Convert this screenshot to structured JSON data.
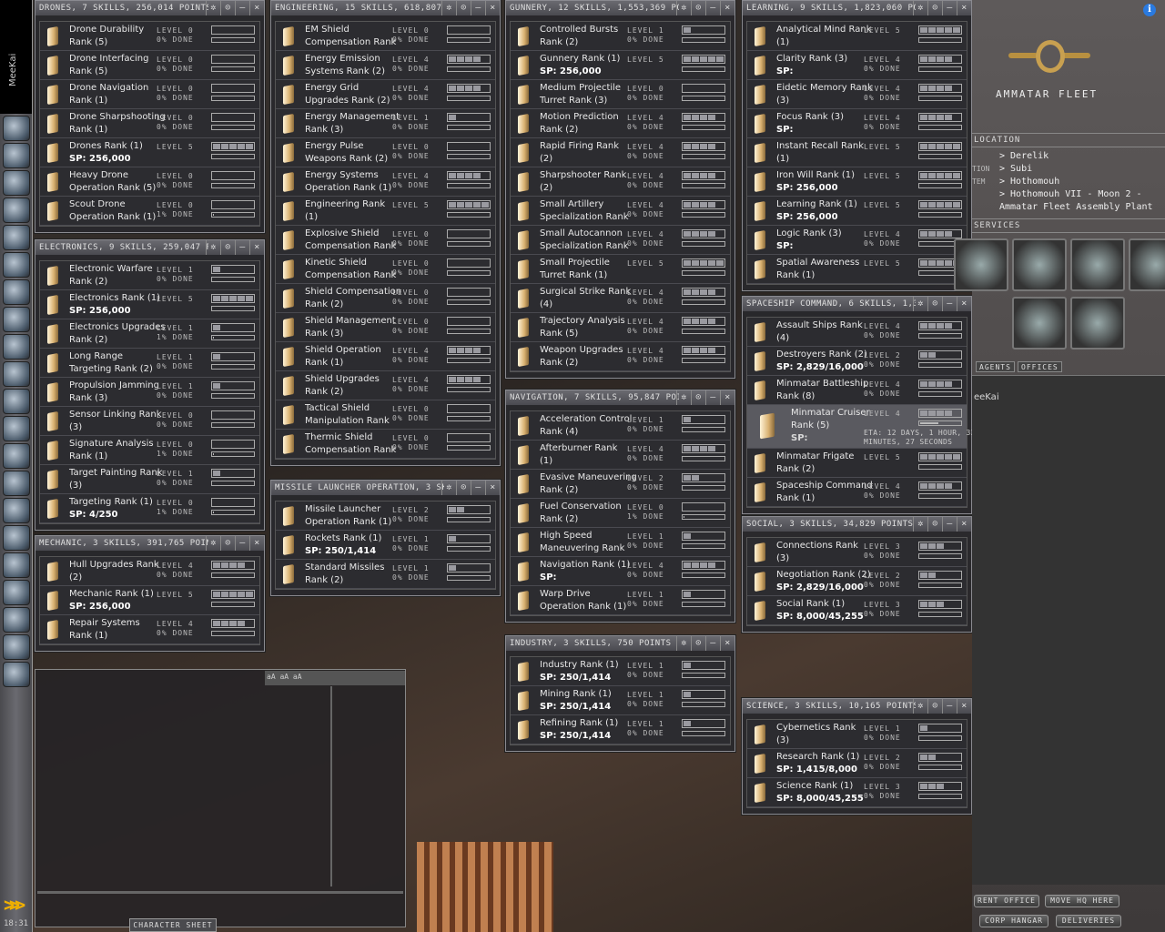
{
  "sidebar": {
    "character": "MeeKai",
    "clock": "18:31",
    "icons": [
      "character-sheet",
      "people-places",
      "mail",
      "notepad",
      "assets",
      "wallet",
      "journal",
      "map",
      "starmap",
      "market",
      "science",
      "corporation",
      "help",
      "fitting",
      "browser",
      "evemail",
      "fleet",
      "info",
      "portrait",
      "ship-hangar",
      "items-hangar"
    ]
  },
  "panels": [
    {
      "title": "DRONES, 7 SKILLS, 256,014 POINTS",
      "skills": [
        {
          "a": "Drone Durability",
          "b": "Rank (5)",
          "level": "LEVEL 0",
          "done": "0% DONE",
          "lv": 0,
          "pct": 0
        },
        {
          "a": "Drone Interfacing",
          "b": "Rank (5)",
          "level": "LEVEL 0",
          "done": "0% DONE",
          "lv": 0,
          "pct": 0
        },
        {
          "a": "Drone Navigation",
          "b": "Rank (1)",
          "level": "LEVEL 0",
          "done": "0% DONE",
          "lv": 0,
          "pct": 0
        },
        {
          "a": "Drone Sharpshooting",
          "b": "Rank (1)",
          "level": "LEVEL 0",
          "done": "0% DONE",
          "lv": 0,
          "pct": 0
        },
        {
          "a": "Drones Rank (1)",
          "b": "SP: 256,000",
          "sp": true,
          "level": "LEVEL 5",
          "done": "",
          "lv": 5,
          "pct": 0
        },
        {
          "a": "Heavy Drone",
          "b": "Operation Rank (5)",
          "level": "LEVEL 0",
          "done": "0% DONE",
          "lv": 0,
          "pct": 0
        },
        {
          "a": "Scout Drone",
          "b": "Operation Rank (1)",
          "level": "LEVEL 0",
          "done": "1% DONE",
          "lv": 0,
          "pct": 1
        }
      ]
    },
    {
      "title": "ELECTRONICS, 9 SKILLS, 259,047 POINT",
      "skills": [
        {
          "a": "Electronic Warfare",
          "b": "Rank (2)",
          "level": "LEVEL 1",
          "done": "0% DONE",
          "lv": 1,
          "pct": 0
        },
        {
          "a": "Electronics Rank (1)",
          "b": "SP: 256,000",
          "sp": true,
          "level": "LEVEL 5",
          "done": "",
          "lv": 5,
          "pct": 0
        },
        {
          "a": "Electronics Upgrades",
          "b": "Rank (2)",
          "level": "LEVEL 1",
          "done": "1% DONE",
          "lv": 1,
          "pct": 1
        },
        {
          "a": "Long Range",
          "b": "Targeting Rank (2)",
          "level": "LEVEL 1",
          "done": "0% DONE",
          "lv": 1,
          "pct": 0
        },
        {
          "a": "Propulsion Jamming",
          "b": "Rank (3)",
          "level": "LEVEL 1",
          "done": "0% DONE",
          "lv": 1,
          "pct": 0
        },
        {
          "a": "Sensor Linking Rank",
          "b": "(3)",
          "level": "LEVEL 0",
          "done": "0% DONE",
          "lv": 0,
          "pct": 0
        },
        {
          "a": "Signature Analysis",
          "b": "Rank (1)",
          "level": "LEVEL 0",
          "done": "1% DONE",
          "lv": 0,
          "pct": 1
        },
        {
          "a": "Target Painting Rank",
          "b": "(3)",
          "level": "LEVEL 1",
          "done": "0% DONE",
          "lv": 1,
          "pct": 0
        },
        {
          "a": "Targeting Rank (1)",
          "b": "SP: 4/250",
          "sp": true,
          "level": "LEVEL 0",
          "done": "1% DONE",
          "lv": 0,
          "pct": 1
        }
      ]
    },
    {
      "title": "MECHANIC, 3 SKILLS, 391,765 POINTS",
      "skills": [
        {
          "a": "Hull Upgrades Rank",
          "b": "(2)",
          "level": "LEVEL 4",
          "done": "0% DONE",
          "lv": 4,
          "pct": 0
        },
        {
          "a": "Mechanic Rank (1)",
          "b": "SP: 256,000",
          "sp": true,
          "level": "LEVEL 5",
          "done": "",
          "lv": 5,
          "pct": 0
        },
        {
          "a": "Repair Systems",
          "b": "Rank (1)",
          "level": "LEVEL 4",
          "done": "0% DONE",
          "lv": 4,
          "pct": 0
        }
      ]
    },
    {
      "title": "ENGINEERING, 15 SKILLS, 618,807 POIN",
      "skills": [
        {
          "a": "EM Shield",
          "b": "Compensation Rank",
          "level": "LEVEL 0",
          "done": "0% DONE",
          "lv": 0,
          "pct": 0
        },
        {
          "a": "Energy Emission",
          "b": "Systems Rank (2)",
          "level": "LEVEL 4",
          "done": "0% DONE",
          "lv": 4,
          "pct": 0
        },
        {
          "a": "Energy Grid",
          "b": "Upgrades Rank (2)",
          "level": "LEVEL 4",
          "done": "0% DONE",
          "lv": 4,
          "pct": 0
        },
        {
          "a": "Energy Management",
          "b": "Rank (3)",
          "level": "LEVEL 1",
          "done": "0% DONE",
          "lv": 1,
          "pct": 0
        },
        {
          "a": "Energy Pulse",
          "b": "Weapons Rank (2)",
          "level": "LEVEL 0",
          "done": "0% DONE",
          "lv": 0,
          "pct": 0
        },
        {
          "a": "Energy Systems",
          "b": "Operation Rank (1)",
          "level": "LEVEL 4",
          "done": "0% DONE",
          "lv": 4,
          "pct": 0
        },
        {
          "a": "Engineering Rank",
          "b": "(1)",
          "level": "LEVEL 5",
          "done": "",
          "lv": 5,
          "pct": 0
        },
        {
          "a": "Explosive Shield",
          "b": "Compensation Rank",
          "level": "LEVEL 0",
          "done": "0% DONE",
          "lv": 0,
          "pct": 0
        },
        {
          "a": "Kinetic Shield",
          "b": "Compensation Rank",
          "level": "LEVEL 0",
          "done": "0% DONE",
          "lv": 0,
          "pct": 0
        },
        {
          "a": "Shield Compensation",
          "b": "Rank (2)",
          "level": "LEVEL 0",
          "done": "0% DONE",
          "lv": 0,
          "pct": 0
        },
        {
          "a": "Shield Management",
          "b": "Rank (3)",
          "level": "LEVEL 0",
          "done": "0% DONE",
          "lv": 0,
          "pct": 0
        },
        {
          "a": "Shield Operation",
          "b": "Rank (1)",
          "level": "LEVEL 4",
          "done": "0% DONE",
          "lv": 4,
          "pct": 0
        },
        {
          "a": "Shield Upgrades",
          "b": "Rank (2)",
          "level": "LEVEL 4",
          "done": "0% DONE",
          "lv": 4,
          "pct": 0
        },
        {
          "a": "Tactical Shield",
          "b": "Manipulation Rank",
          "level": "LEVEL 0",
          "done": "0% DONE",
          "lv": 0,
          "pct": 0
        },
        {
          "a": "Thermic Shield",
          "b": "Compensation Rank",
          "level": "LEVEL 0",
          "done": "0% DONE",
          "lv": 0,
          "pct": 0
        }
      ]
    },
    {
      "title": "MISSILE LAUNCHER OPERATION, 3 SKILL",
      "skills": [
        {
          "a": "Missile Launcher",
          "b": "Operation Rank (1)",
          "level": "LEVEL 2",
          "done": "0% DONE",
          "lv": 2,
          "pct": 0
        },
        {
          "a": "Rockets Rank (1)",
          "b": "SP: 250/1,414",
          "sp": true,
          "level": "LEVEL 1",
          "done": "0% DONE",
          "lv": 1,
          "pct": 0
        },
        {
          "a": "Standard Missiles",
          "b": "Rank (2)",
          "level": "LEVEL 1",
          "done": "0% DONE",
          "lv": 1,
          "pct": 0
        }
      ]
    },
    {
      "title": "GUNNERY, 12 SKILLS, 1,553,369 POINT",
      "skills": [
        {
          "a": "Controlled Bursts",
          "b": "Rank (2)",
          "level": "LEVEL 1",
          "done": "0% DONE",
          "lv": 1,
          "pct": 0
        },
        {
          "a": "Gunnery Rank (1)",
          "b": "SP: 256,000",
          "sp": true,
          "level": "LEVEL 5",
          "done": "",
          "lv": 5,
          "pct": 0
        },
        {
          "a": "Medium Projectile",
          "b": "Turret Rank (3)",
          "level": "LEVEL 0",
          "done": "0% DONE",
          "lv": 0,
          "pct": 0
        },
        {
          "a": "Motion Prediction",
          "b": "Rank (2)",
          "level": "LEVEL 4",
          "done": "0% DONE",
          "lv": 4,
          "pct": 0
        },
        {
          "a": "Rapid Firing Rank",
          "b": "(2)",
          "level": "LEVEL 4",
          "done": "0% DONE",
          "lv": 4,
          "pct": 0
        },
        {
          "a": "Sharpshooter Rank",
          "b": "(2)",
          "level": "LEVEL 4",
          "done": "0% DONE",
          "lv": 4,
          "pct": 0
        },
        {
          "a": "Small Artillery",
          "b": "Specialization Rank",
          "level": "LEVEL 4",
          "done": "0% DONE",
          "lv": 4,
          "pct": 0
        },
        {
          "a": "Small Autocannon",
          "b": "Specialization Rank",
          "level": "LEVEL 4",
          "done": "0% DONE",
          "lv": 4,
          "pct": 0
        },
        {
          "a": "Small Projectile",
          "b": "Turret Rank (1)",
          "level": "LEVEL 5",
          "done": "",
          "lv": 5,
          "pct": 0
        },
        {
          "a": "Surgical Strike Rank",
          "b": "(4)",
          "level": "LEVEL 4",
          "done": "0% DONE",
          "lv": 4,
          "pct": 0
        },
        {
          "a": "Trajectory Analysis",
          "b": "Rank (5)",
          "level": "LEVEL 4",
          "done": "0% DONE",
          "lv": 4,
          "pct": 0
        },
        {
          "a": "Weapon Upgrades",
          "b": "Rank (2)",
          "level": "LEVEL 4",
          "done": "0% DONE",
          "lv": 4,
          "pct": 0
        }
      ]
    },
    {
      "title": "NAVIGATION, 7 SKILLS, 95,847 POINTS",
      "skills": [
        {
          "a": "Acceleration Control",
          "b": "Rank (4)",
          "level": "LEVEL 1",
          "done": "0% DONE",
          "lv": 1,
          "pct": 0
        },
        {
          "a": "Afterburner Rank",
          "b": "(1)",
          "level": "LEVEL 4",
          "done": "0% DONE",
          "lv": 4,
          "pct": 0
        },
        {
          "a": "Evasive Maneuvering",
          "b": "Rank (2)",
          "level": "LEVEL 2",
          "done": "0% DONE",
          "lv": 2,
          "pct": 0
        },
        {
          "a": "Fuel Conservation",
          "b": "Rank (2)",
          "level": "LEVEL 0",
          "done": "1% DONE",
          "lv": 0,
          "pct": 1
        },
        {
          "a": "High Speed",
          "b": "Maneuvering Rank",
          "level": "LEVEL 1",
          "done": "0% DONE",
          "lv": 1,
          "pct": 0
        },
        {
          "a": "Navigation Rank (1)",
          "b": "SP:",
          "sp": true,
          "level": "LEVEL 4",
          "done": "0% DONE",
          "lv": 4,
          "pct": 0
        },
        {
          "a": "Warp Drive",
          "b": "Operation Rank (1)",
          "level": "LEVEL 1",
          "done": "0% DONE",
          "lv": 1,
          "pct": 0
        }
      ]
    },
    {
      "title": "INDUSTRY, 3 SKILLS, 750 POINTS",
      "skills": [
        {
          "a": "Industry Rank (1)",
          "b": "SP: 250/1,414",
          "sp": true,
          "level": "LEVEL 1",
          "done": "0% DONE",
          "lv": 1,
          "pct": 0
        },
        {
          "a": "Mining Rank (1)",
          "b": "SP: 250/1,414",
          "sp": true,
          "level": "LEVEL 1",
          "done": "0% DONE",
          "lv": 1,
          "pct": 0
        },
        {
          "a": "Refining Rank (1)",
          "b": "SP: 250/1,414",
          "sp": true,
          "level": "LEVEL 1",
          "done": "0% DONE",
          "lv": 1,
          "pct": 0
        }
      ]
    },
    {
      "title": "LEARNING, 9 SKILLS, 1,823,060 POINTS",
      "skills": [
        {
          "a": "Analytical Mind Rank",
          "b": "(1)",
          "level": "LEVEL 5",
          "done": "",
          "lv": 5,
          "pct": 0
        },
        {
          "a": "Clarity Rank (3)",
          "b": "SP:",
          "sp": true,
          "level": "LEVEL 4",
          "done": "0% DONE",
          "lv": 4,
          "pct": 0
        },
        {
          "a": "Eidetic Memory Rank",
          "b": "(3)",
          "level": "LEVEL 4",
          "done": "0% DONE",
          "lv": 4,
          "pct": 0
        },
        {
          "a": "Focus Rank (3)",
          "b": "SP:",
          "sp": true,
          "level": "LEVEL 4",
          "done": "0% DONE",
          "lv": 4,
          "pct": 0
        },
        {
          "a": "Instant Recall Rank",
          "b": "(1)",
          "level": "LEVEL 5",
          "done": "",
          "lv": 5,
          "pct": 0
        },
        {
          "a": "Iron Will Rank (1)",
          "b": "SP: 256,000",
          "sp": true,
          "level": "LEVEL 5",
          "done": "",
          "lv": 5,
          "pct": 0
        },
        {
          "a": "Learning Rank (1)",
          "b": "SP: 256,000",
          "sp": true,
          "level": "LEVEL 5",
          "done": "",
          "lv": 5,
          "pct": 0
        },
        {
          "a": "Logic Rank (3)",
          "b": "SP:",
          "sp": true,
          "level": "LEVEL 4",
          "done": "0% DONE",
          "lv": 4,
          "pct": 0
        },
        {
          "a": "Spatial Awareness",
          "b": "Rank (1)",
          "level": "LEVEL 5",
          "done": "",
          "lv": 5,
          "pct": 0
        }
      ]
    },
    {
      "title": "SPACESHIP COMMAND, 6 SKILLS, 1,329",
      "skills": [
        {
          "a": "Assault Ships Rank",
          "b": "(4)",
          "level": "LEVEL 4",
          "done": "0% DONE",
          "lv": 4,
          "pct": 0
        },
        {
          "a": "Destroyers Rank (2)",
          "b": "SP: 2,829/16,000",
          "sp": true,
          "level": "LEVEL 2",
          "done": "0% DONE",
          "lv": 2,
          "pct": 0
        },
        {
          "a": "Minmatar Battleship",
          "b": "Rank (8)",
          "level": "LEVEL 4",
          "done": "0% DONE",
          "lv": 4,
          "pct": 0
        },
        {
          "a": "Minmatar Cruiser",
          "b": "Rank (5)",
          "c": "SP:",
          "training": true,
          "level": "LEVEL 4",
          "done": "",
          "eta": "ETA: 12 DAYS, 1 HOUR, 32 MINUTES, 27 SECONDS",
          "lv": 4,
          "pct": 45
        },
        {
          "a": "Minmatar Frigate",
          "b": "Rank (2)",
          "level": "LEVEL 5",
          "done": "",
          "lv": 5,
          "pct": 0
        },
        {
          "a": "Spaceship Command",
          "b": "Rank (1)",
          "level": "LEVEL 4",
          "done": "0% DONE",
          "lv": 4,
          "pct": 0
        }
      ]
    },
    {
      "title": "SOCIAL, 3 SKILLS, 34,829 POINTS",
      "skills": [
        {
          "a": "Connections Rank",
          "b": "(3)",
          "level": "LEVEL 3",
          "done": "0% DONE",
          "lv": 3,
          "pct": 0
        },
        {
          "a": "Negotiation Rank (2)",
          "b": "SP: 2,829/16,000",
          "sp": true,
          "level": "LEVEL 2",
          "done": "0% DONE",
          "lv": 2,
          "pct": 0
        },
        {
          "a": "Social Rank (1)",
          "b": "SP: 8,000/45,255",
          "sp": true,
          "level": "LEVEL 3",
          "done": "0% DONE",
          "lv": 3,
          "pct": 0
        }
      ]
    },
    {
      "title": "SCIENCE, 3 SKILLS, 10,165 POINTS",
      "skills": [
        {
          "a": "Cybernetics Rank",
          "b": "(3)",
          "level": "LEVEL 1",
          "done": "0% DONE",
          "lv": 1,
          "pct": 0
        },
        {
          "a": "Research Rank (1)",
          "b": "SP: 1,415/8,000",
          "sp": true,
          "level": "LEVEL 2",
          "done": "0% DONE",
          "lv": 2,
          "pct": 0
        },
        {
          "a": "Science Rank (1)",
          "b": "SP: 8,000/45,255",
          "sp": true,
          "level": "LEVEL 3",
          "done": "0% DONE",
          "lv": 3,
          "pct": 0
        }
      ]
    }
  ],
  "station": {
    "corp": "AMMATAR FLEET",
    "location_heading": "LOCATION",
    "loc": [
      {
        "label": "",
        "value": "> Derelik"
      },
      {
        "label": "TION",
        "value": "> Subi"
      },
      {
        "label": "TEM",
        "value": "> Hothomouh"
      },
      {
        "label": "",
        "value": "> Hothomouh VII - Moon 2 -"
      },
      {
        "label": "",
        "value": "Ammatar Fleet Assembly Plant"
      }
    ],
    "services_heading": "SERVICES",
    "services": [
      "repair-shop",
      "reprocessing-plant",
      "factory",
      "laboratory",
      "bounty-office",
      "fitting"
    ],
    "tabs": [
      "AGENTS",
      "OFFICES"
    ],
    "guest": "eeKai",
    "buttons": [
      "RENT OFFICE",
      "MOVE HQ HERE",
      "CORP HANGAR",
      "DELIVERIES"
    ]
  },
  "chat": {
    "tab": "CHARACTER SHEET",
    "toolbar": "aA aA aA"
  },
  "window_buttons": [
    "✲",
    "⊙",
    "–",
    "×"
  ],
  "colors": {
    "panel_bg": "#2c2c30",
    "title_bar": "#5a5a60",
    "level_fill": "#9a9aa0",
    "info": "#2a7ae0",
    "accent": "#f0b000"
  }
}
